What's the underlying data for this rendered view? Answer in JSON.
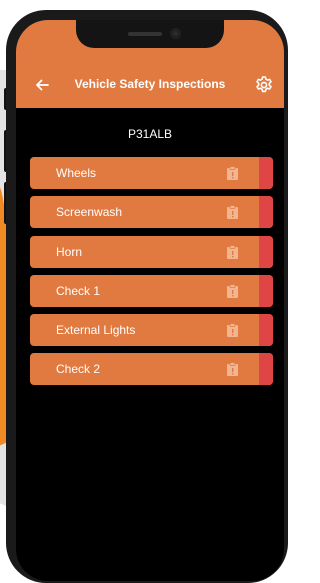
{
  "header": {
    "title": "Vehicle Safety Inspections",
    "back_icon": "arrow-left-icon",
    "settings_icon": "gear-icon"
  },
  "vehicle": {
    "registration": "P31ALB"
  },
  "checks": [
    {
      "label": "Wheels",
      "icon": "clipboard-icon",
      "status_color": "#e04545"
    },
    {
      "label": "Screenwash",
      "icon": "clipboard-icon",
      "status_color": "#e04545"
    },
    {
      "label": "Horn",
      "icon": "clipboard-icon",
      "status_color": "#e04545"
    },
    {
      "label": "Check 1",
      "icon": "clipboard-icon",
      "status_color": "#e04545"
    },
    {
      "label": "External Lights",
      "icon": "clipboard-icon",
      "status_color": "#e04545"
    },
    {
      "label": "Check 2",
      "icon": "clipboard-icon",
      "status_color": "#e04545"
    }
  ],
  "colors": {
    "accent": "#e07a40",
    "status_incomplete": "#e04545",
    "background": "#000000"
  }
}
